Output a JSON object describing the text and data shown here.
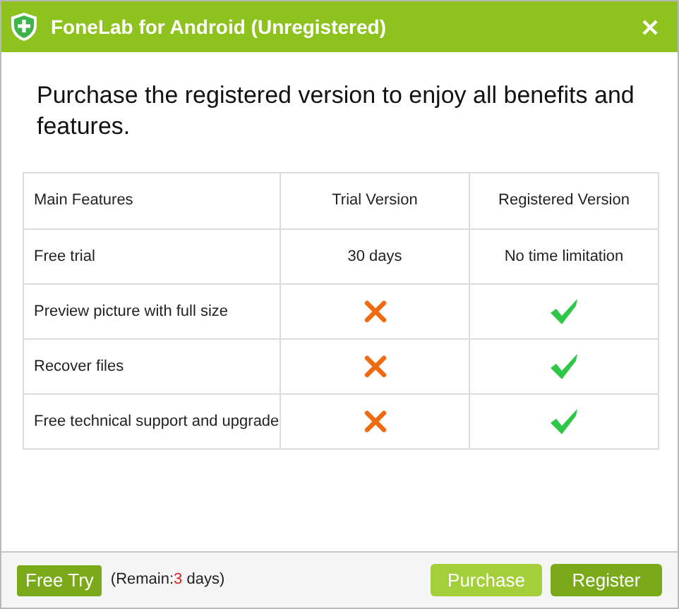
{
  "window": {
    "title": "FoneLab for Android (Unregistered)"
  },
  "heading": "Purchase the registered version to enjoy all benefits and features.",
  "table": {
    "columns": [
      "Main Features",
      "Trial Version",
      "Registered Version"
    ],
    "rows": [
      [
        {
          "kind": "text",
          "text": "Free trial"
        },
        {
          "kind": "text",
          "text": "30 days"
        },
        {
          "kind": "text",
          "text": "No time limitation"
        }
      ],
      [
        {
          "kind": "text",
          "text": "Preview picture with full size"
        },
        {
          "kind": "cross"
        },
        {
          "kind": "check"
        }
      ],
      [
        {
          "kind": "text",
          "text": "Recover files"
        },
        {
          "kind": "cross"
        },
        {
          "kind": "check"
        }
      ],
      [
        {
          "kind": "text",
          "text": "Free technical support and upgrade"
        },
        {
          "kind": "cross"
        },
        {
          "kind": "check"
        }
      ]
    ]
  },
  "footer": {
    "free_try": "Free Try",
    "remain_prefix": "(Remain:",
    "remain_days": "3",
    "remain_suffix": " days)",
    "purchase": "Purchase",
    "register": "Register"
  }
}
